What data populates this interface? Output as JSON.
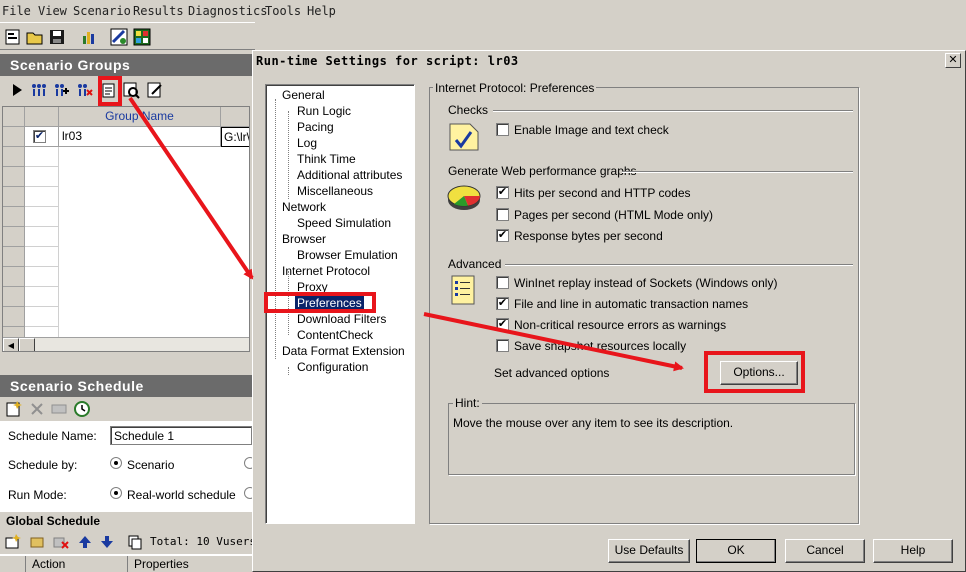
{
  "menu": [
    "File",
    "View",
    "Scenario",
    "Results",
    "Diagnostics",
    "Tools",
    "Help"
  ],
  "groups_panel": {
    "title": "Scenario Groups",
    "column_header": "Group Name",
    "rows": [
      {
        "checked": true,
        "group": "lr03",
        "path": "G:\\lr\\"
      }
    ]
  },
  "schedule_panel": {
    "title": "Scenario Schedule",
    "schedule_name_label": "Schedule Name:",
    "schedule_name_value": "Schedule 1",
    "schedule_by_label": "Schedule by:",
    "schedule_by_option": "Scenario",
    "run_mode_label": "Run Mode:",
    "run_mode_option": "Real-world schedule",
    "global_title": "Global Schedule",
    "total_label": "Total: 10 Vusers",
    "columns": [
      "Action",
      "Properties"
    ]
  },
  "dialog": {
    "title": "Run-time Settings for script: lr03",
    "close_glyph": "✕",
    "tree": [
      {
        "label": "General",
        "level": 0
      },
      {
        "label": "Run Logic",
        "level": 1
      },
      {
        "label": "Pacing",
        "level": 1
      },
      {
        "label": "Log",
        "level": 1
      },
      {
        "label": "Think Time",
        "level": 1
      },
      {
        "label": "Additional attributes",
        "level": 1
      },
      {
        "label": "Miscellaneous",
        "level": 1
      },
      {
        "label": "Network",
        "level": 0
      },
      {
        "label": "Speed Simulation",
        "level": 1
      },
      {
        "label": "Browser",
        "level": 0
      },
      {
        "label": "Browser Emulation",
        "level": 1
      },
      {
        "label": "Internet Protocol",
        "level": 0
      },
      {
        "label": "Proxy",
        "level": 1
      },
      {
        "label": "Preferences",
        "level": 1,
        "selected": true
      },
      {
        "label": "Download Filters",
        "level": 1
      },
      {
        "label": "ContentCheck",
        "level": 1
      },
      {
        "label": "Data Format Extension",
        "level": 0
      },
      {
        "label": "Configuration",
        "level": 1
      }
    ],
    "group_title": "Internet Protocol: Preferences",
    "checks": {
      "title": "Checks",
      "items": [
        {
          "label": "Enable Image and text check",
          "checked": false
        }
      ]
    },
    "perf": {
      "title": "Generate Web performance graphs",
      "items": [
        {
          "label": "Hits per second and HTTP codes",
          "checked": true
        },
        {
          "label": "Pages per second (HTML Mode only)",
          "checked": false
        },
        {
          "label": "Response bytes per second",
          "checked": true
        }
      ]
    },
    "advanced": {
      "title": "Advanced",
      "items": [
        {
          "label": "WinInet replay instead of Sockets (Windows only)",
          "checked": false
        },
        {
          "label": "File and line in automatic transaction names",
          "checked": true
        },
        {
          "label": "Non-critical resource errors as warnings",
          "checked": true
        },
        {
          "label": "Save snapshot resources locally",
          "checked": false
        }
      ],
      "set_options_label": "Set advanced options",
      "options_button": "Options..."
    },
    "hint": {
      "title": "Hint:",
      "text": "Move the mouse over any item to see its description."
    },
    "buttons": {
      "defaults": "Use Defaults",
      "ok": "OK",
      "cancel": "Cancel",
      "help": "Help"
    }
  },
  "check_glyph": "✔",
  "colors": {
    "highlight": "#e8151b",
    "selection": "#0a246a",
    "panel_title": "#6b6b6b"
  }
}
